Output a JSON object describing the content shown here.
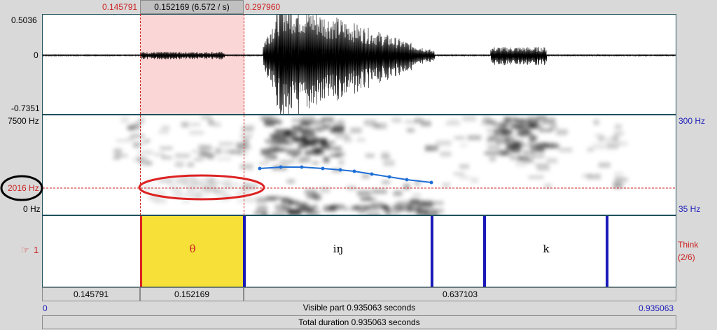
{
  "top_times": {
    "left": "0.145791",
    "selection": "0.152169 (6.572 / s)",
    "right": "0.297960"
  },
  "waveform": {
    "max_label": "0.5036",
    "zero_label": "0",
    "min_label": "-0.7351"
  },
  "spectrogram": {
    "top_freq": "7500 Hz",
    "cursor_freq": "2016 Hz",
    "bottom_freq": "0 Hz",
    "pitch_top": "300 Hz",
    "pitch_bottom": "35 Hz"
  },
  "tier": {
    "number": "1",
    "name": "Think",
    "count": "(2/6)",
    "intervals": [
      "θ",
      "iŋ",
      "k"
    ]
  },
  "bottom": {
    "seg_left": "0.145791",
    "seg_selected": "0.152169",
    "seg_right": "0.637103",
    "start": "0",
    "visible": "Visible part 0.935063 seconds",
    "end": "0.935063",
    "total": "Total duration 0.935063 seconds"
  },
  "colors": {
    "selection": "#fbd6d6",
    "interval_highlight": "#f7e037",
    "boundary": "#1a1ab8",
    "pitch": "#1f6fd6",
    "annotation": "#dd2222"
  }
}
